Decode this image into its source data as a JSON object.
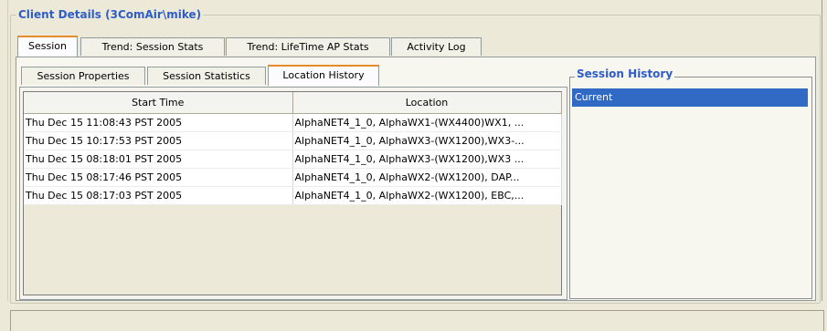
{
  "group_title": "Client Details (3ComAir\\mike)",
  "outer_tabs": [
    {
      "label": "Session",
      "active": true
    },
    {
      "label": "Trend: Session Stats",
      "active": false
    },
    {
      "label": "Trend: LifeTime AP Stats",
      "active": false
    },
    {
      "label": "Activity Log",
      "active": false
    }
  ],
  "inner_tabs": [
    {
      "label": "Session Properties",
      "active": false
    },
    {
      "label": "Session Statistics",
      "active": false
    },
    {
      "label": "Location History",
      "active": true
    }
  ],
  "table": {
    "columns": [
      "Start Time",
      "Location"
    ],
    "rows": [
      [
        "Thu Dec 15 11:08:43 PST 2005",
        "AlphaNET4_1_0, AlphaWX1-(WX4400)WX1, ..."
      ],
      [
        "Thu Dec 15 10:17:53 PST 2005",
        "AlphaNET4_1_0, AlphaWX3-(WX1200),WX3-..."
      ],
      [
        "Thu Dec 15 08:18:01 PST 2005",
        "AlphaNET4_1_0, AlphaWX3-(WX1200),WX3 ..."
      ],
      [
        "Thu Dec 15 08:17:46 PST 2005",
        "AlphaNET4_1_0, AlphaWX2-(WX1200), DAP..."
      ],
      [
        "Thu Dec 15 08:17:03 PST 2005",
        "AlphaNET4_1_0, AlphaWX2-(WX1200), EBC,..."
      ]
    ]
  },
  "session_history": {
    "title": "Session History",
    "items": [
      "Current"
    ]
  },
  "colors": {
    "title_blue": "#2f5dc7",
    "selection_blue": "#316ac5",
    "active_tab_accent": "#e68b2c"
  }
}
